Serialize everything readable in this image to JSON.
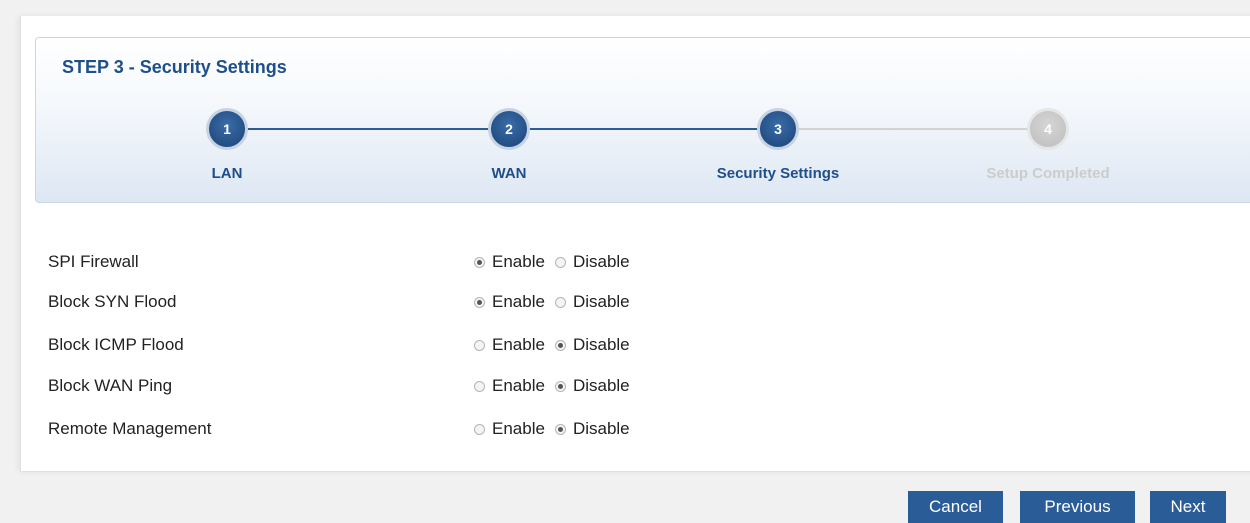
{
  "wizard": {
    "title": "STEP 3 - Security Settings",
    "steps": [
      {
        "number": "1",
        "label": "LAN",
        "state": "done"
      },
      {
        "number": "2",
        "label": "WAN",
        "state": "done"
      },
      {
        "number": "3",
        "label": "Security Settings",
        "state": "current"
      },
      {
        "number": "4",
        "label": "Setup Completed",
        "state": "pending"
      }
    ]
  },
  "settings": {
    "enable_label": "Enable",
    "disable_label": "Disable",
    "rows": [
      {
        "label": "SPI Firewall",
        "value": "Enable"
      },
      {
        "label": "Block SYN Flood",
        "value": "Enable"
      },
      {
        "label": "Block ICMP Flood",
        "value": "Disable"
      },
      {
        "label": "Block WAN Ping",
        "value": "Disable"
      },
      {
        "label": "Remote Management",
        "value": "Disable"
      }
    ]
  },
  "buttons": {
    "cancel": "Cancel",
    "previous": "Previous",
    "next": "Next"
  },
  "colors": {
    "accent": "#1e4f8c",
    "button": "#2a5d97",
    "inactive": "#cccccc"
  }
}
